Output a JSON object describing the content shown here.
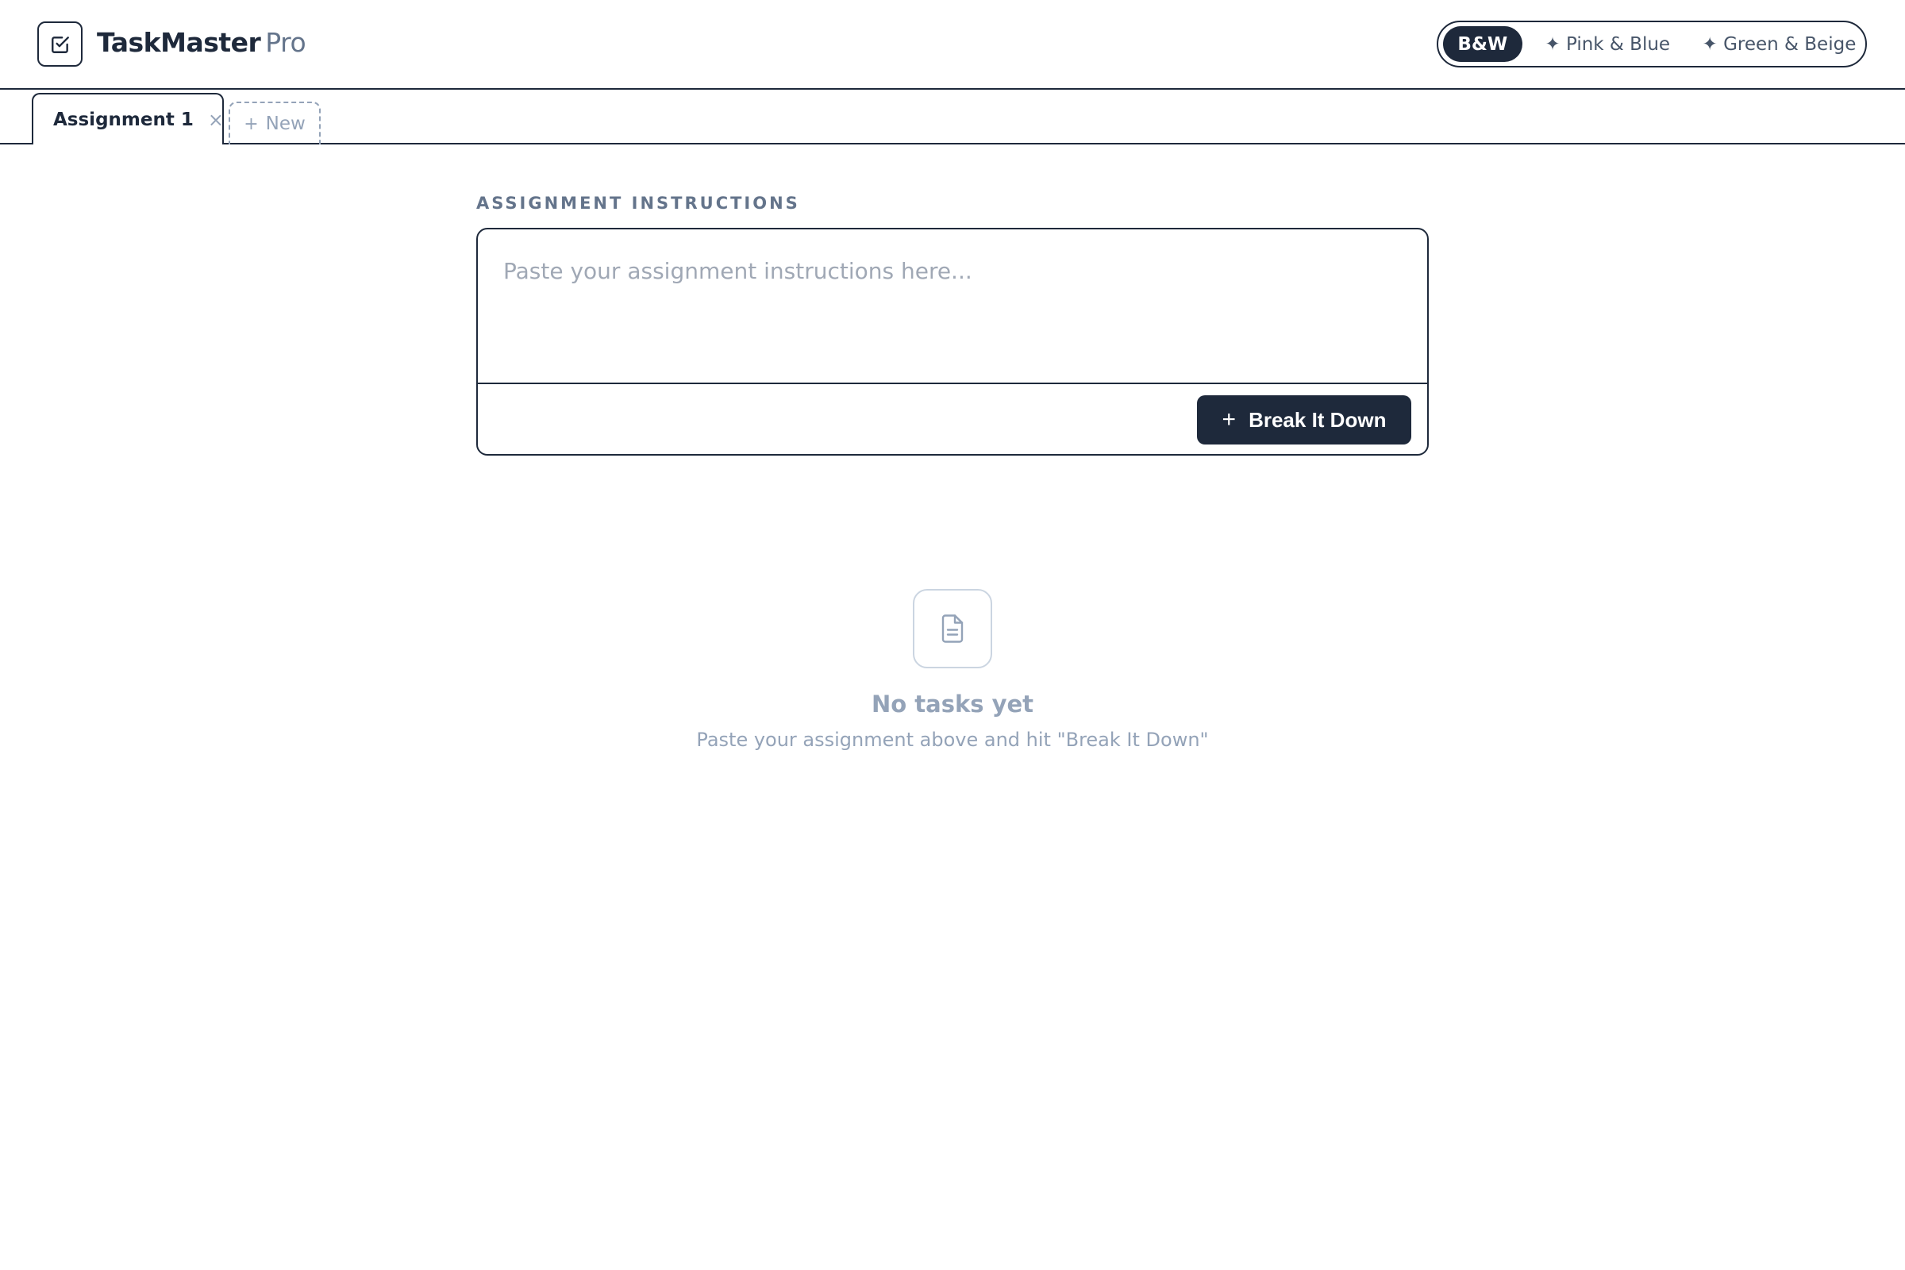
{
  "app": {
    "brand_main": "TaskMaster",
    "brand_sub": "Pro",
    "logo_icon": "checkbox-icon"
  },
  "themes": {
    "active": "B&W",
    "options": [
      "B&W",
      "✦ Pink & Blue",
      "✦ Green & Beige"
    ]
  },
  "tabs": {
    "items": [
      {
        "label": "Assignment 1",
        "close": "×"
      }
    ],
    "new_plus": "+",
    "new_label": "New"
  },
  "instructions": {
    "section_label": "ASSIGNMENT INSTRUCTIONS",
    "value": "",
    "placeholder": "Paste your assignment instructions here...",
    "button_icon": "+",
    "button_label": "Break It Down"
  },
  "empty_state": {
    "icon": "document-icon",
    "title": "No tasks yet",
    "subtitle": "Paste your assignment above and hit \"Break It Down\""
  },
  "colors": {
    "primary": "#1e293b",
    "muted": "#94a3b8",
    "label": "#64748b"
  }
}
